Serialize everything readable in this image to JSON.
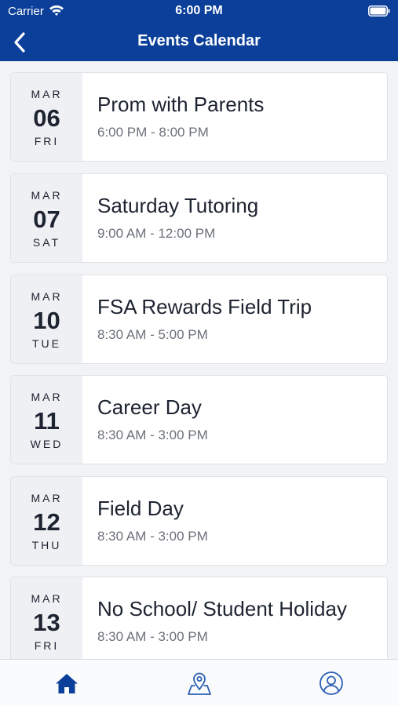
{
  "status": {
    "carrier": "Carrier",
    "time": "6:00 PM"
  },
  "nav": {
    "title": "Events Calendar"
  },
  "events": [
    {
      "month": "MAR",
      "day": "06",
      "weekday": "FRI",
      "title": "Prom with Parents",
      "time": "6:00 PM - 8:00 PM"
    },
    {
      "month": "MAR",
      "day": "07",
      "weekday": "SAT",
      "title": "Saturday Tutoring",
      "time": "9:00 AM - 12:00 PM"
    },
    {
      "month": "MAR",
      "day": "10",
      "weekday": "TUE",
      "title": "FSA Rewards Field Trip",
      "time": "8:30 AM - 5:00 PM"
    },
    {
      "month": "MAR",
      "day": "11",
      "weekday": "WED",
      "title": "Career Day",
      "time": "8:30 AM - 3:00 PM"
    },
    {
      "month": "MAR",
      "day": "12",
      "weekday": "THU",
      "title": "Field Day",
      "time": "8:30 AM - 3:00 PM"
    },
    {
      "month": "MAR",
      "day": "13",
      "weekday": "FRI",
      "title": "No School/ Student Holiday",
      "time": "8:30 AM - 3:00 PM"
    }
  ],
  "tabs": [
    {
      "icon": "home-icon",
      "active": true
    },
    {
      "icon": "map-pin-icon",
      "active": false
    },
    {
      "icon": "profile-icon",
      "active": false
    }
  ],
  "colors": {
    "brand": "#0b3f99",
    "date_panel": "#eef0f3",
    "active_tab": "#0b3f99",
    "inactive_tab": "#2a5fb5"
  }
}
